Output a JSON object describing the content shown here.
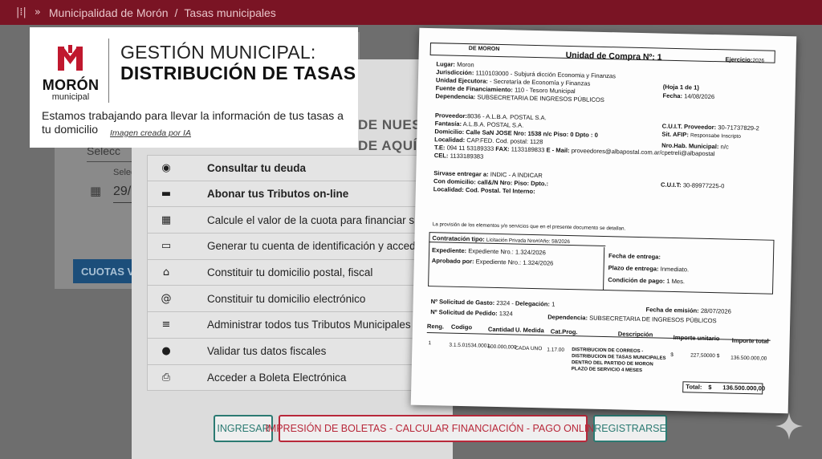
{
  "topbar": {
    "breadcrumb_home": "Municipalidad de Morón",
    "separator": "/",
    "breadcrumb_current": "Tasas municipales",
    "icons": [
      "sidebar-toggle-icon",
      "double-chevron-icon"
    ]
  },
  "background": {
    "field_partial": "Selecc",
    "select_label": "Selec",
    "date_partial": "29/",
    "button_partial": "CUOTAS VI"
  },
  "header_card": {
    "logo_name": "MORÓN",
    "logo_sub": "municipal",
    "title_line1": "GESTIÓN MUNICIPAL:",
    "title_line2": "DISTRIBUCIÓN DE TASAS",
    "message": "Estamos trabajando para llevar la información de tus tasas a tu domicilio",
    "ai_note": "Imagen creada por IA",
    "brand_color": "#c0182e"
  },
  "panel": {
    "heading_line1": "DE NUES",
    "heading_line2": "DE AQUÍ POR",
    "menu": [
      {
        "icon": "eye-icon",
        "label": "Consultar tu deuda",
        "bold": true
      },
      {
        "icon": "credit-card-icon",
        "label": "Abonar tus Tributos on-line",
        "bold": true
      },
      {
        "icon": "calculator-icon",
        "label": "Calcule el valor de la cuota para financiar su deud",
        "bold": false
      },
      {
        "icon": "laptop-icon",
        "label": "Generar tu cuenta de identificación y acceder a tu",
        "bold": false
      },
      {
        "icon": "home-icon",
        "label": "Constituir tu domicilio postal, fiscal",
        "bold": false
      },
      {
        "icon": "at-sign-icon",
        "label": "Constituir tu domicilio electrónico",
        "bold": false
      },
      {
        "icon": "list-icon",
        "label": "Administrar todos tus Tributos Municipales",
        "bold": false
      },
      {
        "icon": "info-icon",
        "label": "Validar tus datos fiscales",
        "bold": false
      },
      {
        "icon": "printer-icon",
        "label": "Acceder a Boleta Electrónica",
        "bold": false
      }
    ],
    "buttons": {
      "ingresar": "INGRESAR",
      "imprimir": "IMPRESIÓN DE BOLETAS - CALCULAR FINANCIACIÓN - PAGO ONLINE",
      "registrar": "REGISTRARSE"
    }
  },
  "document": {
    "org": "DE MORON",
    "unidad": "Unidad de Compra Nº: 1",
    "ejercicio_label": "Ejercicio:",
    "ejercicio": "2026",
    "lugar_label": "Lugar:",
    "lugar": "Moron",
    "jurisdiccion_label": "Jurisdicción:",
    "jurisdiccion": "1110103000 - Subjurá dicción Economia y Finanzas",
    "unidad_ejec_label": "Unidad Ejecutora:",
    "unidad_ejec": "- Secretaría de Economía y Finanzas",
    "fuente_label": "Fuente de Financiamiento:",
    "fuente": "110 - Tesoro Municipal",
    "dependencia_label": "Dependencia:",
    "dependencia": "SUBSECRETARIA DE INGRESOS PÚBLICOS",
    "hoja": "(Hoja 1 de 1)",
    "fecha_label": "Fecha:",
    "fecha": "14/08/2026",
    "proveedor_label": "Proveedor:",
    "proveedor": "8036 - A.L.B.A. POSTAL S.A.",
    "fantasia_label": "Fantasía:",
    "fantasia": "A.L.B.A. POSTAL S.A.",
    "domicilio_label": "Domicilio:",
    "domicilio": "Calle SaN JOSE Nro: 1538 n/c Piso: 0 Dpto : 0",
    "localidad_label": "Localidad:",
    "localidad": "CAP.FED. Cod. postal: 1128",
    "te_label": "T.E:",
    "te": "094  11  53189333",
    "fax_label": "FAX:",
    "fax": "1133189833",
    "email_label": "E - Mail:",
    "email": "proveedores@albapostal.com.ar/cpetreli@albapostal",
    "cel_label": "CEL:",
    "cel": "1133189383",
    "cuit_prov_label": "C.U.I.T. Proveedor:",
    "cuit_prov": "30-71737829-2",
    "sit_afip_label": "Sit. AFIP:",
    "sit_afip": "Responsabe Inscripto",
    "nro_hab_label": "Nro.Hab. Municipal:",
    "nro_hab": "n/c",
    "sirvase_label": "Sirvase entregar a:",
    "sirvase": "INDIC - A INDICAR",
    "con_domicilio_label": "Con domicilio:",
    "con_domicilio": "call&/N  Nro:  Piso:  Dpto.:",
    "localidad2": "Localidad: Cod. Postal. Tel  Interno:",
    "cuit_label": "C.U.I.T:",
    "cuit": "30-89977225-0",
    "provision": "La provisión de los elementos y/o servicios que en el presente documento se detallan.",
    "contratacion_label": "Contratación tipo:",
    "contratacion": "Licitación Privada Nro#/Año: 58/2026",
    "expediente_label": "Expediente:",
    "expediente": "Expediente Nro.: 1.324/2026",
    "aprobado_label": "Aprobado por:",
    "aprobado": "Expediente Nro.: 1.324/2026",
    "fecha_entrega_label": "Fecha de entrega:",
    "plazo_label": "Plazo de entrega:",
    "plazo": "Inmediato.",
    "condicion_label": "Condición de pago:",
    "condicion": "1 Mes.",
    "solicitud_gasto_label": "Nº Solicitud de Gasto:",
    "solicitud_gasto": "2324",
    "delegacion_label": "Delegación:",
    "delegacion": "1",
    "fecha_emision_label": "Fecha de emisión:",
    "fecha_emision": "28/07/2026",
    "solicitud_pedido_label": "Nº Solicitud de Pedido:",
    "solicitud_pedido": "1324",
    "dependencia2_label": "Dependencia:",
    "dependencia2": "SUBSECRETARIA DE INGRESOS PÚBLICOS",
    "table_headers": [
      "Reng.",
      "Codigo",
      "Cantidad",
      "U. Medida",
      "Cat.Prog.",
      "Descripción",
      "Importe unitario",
      "Importe total"
    ],
    "row": {
      "reng": "1",
      "codigo": "3.1.5.01534.0001",
      "cantidad": "600.000,000",
      "medida": "CADA UNO",
      "cat": "1.17.00",
      "desc": [
        "DISTRIBUCION DE CORREOS -",
        "DISTRIBUCION DE TASAS MUNICIPALES",
        "DENTRO DEL PARTIDO DE MORON",
        "PLAZO DE SERVICIO 4 MESES"
      ],
      "unit_currency": "$",
      "unit": "227,50000 $",
      "total": "136.500.000,00"
    },
    "total_label": "Total:",
    "total_currency": "$",
    "total": "136.500.000,00"
  }
}
